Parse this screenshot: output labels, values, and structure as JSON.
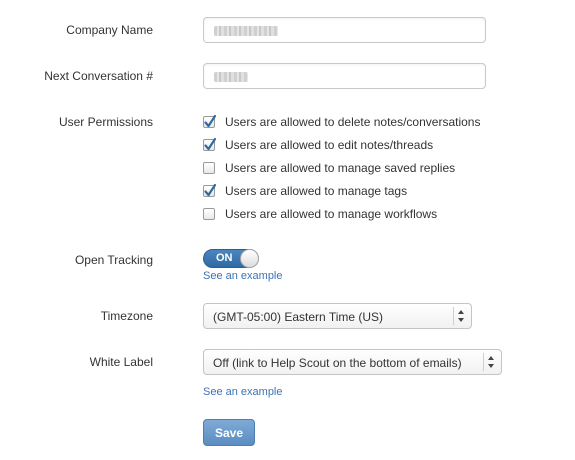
{
  "form": {
    "company_name": {
      "label": "Company Name"
    },
    "next_conversation": {
      "label": "Next Conversation #"
    },
    "permissions": {
      "label": "User Permissions",
      "items": [
        {
          "label": "Users are allowed to delete notes/conversations",
          "checked": true
        },
        {
          "label": "Users are allowed to edit notes/threads",
          "checked": true
        },
        {
          "label": "Users are allowed to manage saved replies",
          "checked": false
        },
        {
          "label": "Users are allowed to manage tags",
          "checked": true
        },
        {
          "label": "Users are allowed to manage workflows",
          "checked": false
        }
      ]
    },
    "open_tracking": {
      "label": "Open Tracking",
      "toggle_text": "ON",
      "link": "See an example"
    },
    "timezone": {
      "label": "Timezone",
      "value": "(GMT-05:00) Eastern Time (US)"
    },
    "white_label": {
      "label": "White Label",
      "value": "Off (link to Help Scout on the bottom of emails)",
      "link": "See an example"
    },
    "save_label": "Save"
  },
  "colors": {
    "accent": "#2f6aa5",
    "link": "#3b73b9",
    "button": "#5b8dc2"
  }
}
